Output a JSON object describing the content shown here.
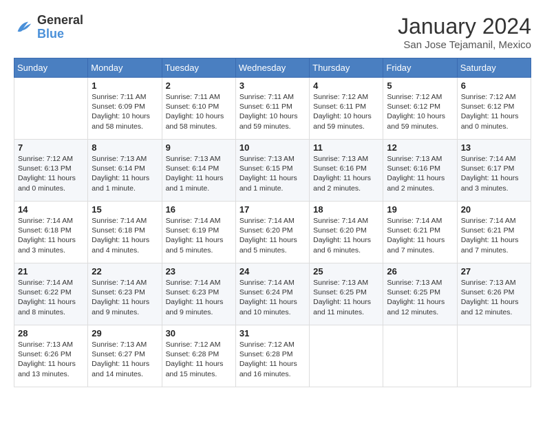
{
  "logo": {
    "general": "General",
    "blue": "Blue"
  },
  "title": "January 2024",
  "location": "San Jose Tejamanil, Mexico",
  "headers": [
    "Sunday",
    "Monday",
    "Tuesday",
    "Wednesday",
    "Thursday",
    "Friday",
    "Saturday"
  ],
  "weeks": [
    [
      {
        "day": "",
        "info": ""
      },
      {
        "day": "1",
        "info": "Sunrise: 7:11 AM\nSunset: 6:09 PM\nDaylight: 10 hours\nand 58 minutes."
      },
      {
        "day": "2",
        "info": "Sunrise: 7:11 AM\nSunset: 6:10 PM\nDaylight: 10 hours\nand 58 minutes."
      },
      {
        "day": "3",
        "info": "Sunrise: 7:11 AM\nSunset: 6:11 PM\nDaylight: 10 hours\nand 59 minutes."
      },
      {
        "day": "4",
        "info": "Sunrise: 7:12 AM\nSunset: 6:11 PM\nDaylight: 10 hours\nand 59 minutes."
      },
      {
        "day": "5",
        "info": "Sunrise: 7:12 AM\nSunset: 6:12 PM\nDaylight: 10 hours\nand 59 minutes."
      },
      {
        "day": "6",
        "info": "Sunrise: 7:12 AM\nSunset: 6:12 PM\nDaylight: 11 hours\nand 0 minutes."
      }
    ],
    [
      {
        "day": "7",
        "info": "Sunrise: 7:12 AM\nSunset: 6:13 PM\nDaylight: 11 hours\nand 0 minutes."
      },
      {
        "day": "8",
        "info": "Sunrise: 7:13 AM\nSunset: 6:14 PM\nDaylight: 11 hours\nand 1 minute."
      },
      {
        "day": "9",
        "info": "Sunrise: 7:13 AM\nSunset: 6:14 PM\nDaylight: 11 hours\nand 1 minute."
      },
      {
        "day": "10",
        "info": "Sunrise: 7:13 AM\nSunset: 6:15 PM\nDaylight: 11 hours\nand 1 minute."
      },
      {
        "day": "11",
        "info": "Sunrise: 7:13 AM\nSunset: 6:16 PM\nDaylight: 11 hours\nand 2 minutes."
      },
      {
        "day": "12",
        "info": "Sunrise: 7:13 AM\nSunset: 6:16 PM\nDaylight: 11 hours\nand 2 minutes."
      },
      {
        "day": "13",
        "info": "Sunrise: 7:14 AM\nSunset: 6:17 PM\nDaylight: 11 hours\nand 3 minutes."
      }
    ],
    [
      {
        "day": "14",
        "info": "Sunrise: 7:14 AM\nSunset: 6:18 PM\nDaylight: 11 hours\nand 3 minutes."
      },
      {
        "day": "15",
        "info": "Sunrise: 7:14 AM\nSunset: 6:18 PM\nDaylight: 11 hours\nand 4 minutes."
      },
      {
        "day": "16",
        "info": "Sunrise: 7:14 AM\nSunset: 6:19 PM\nDaylight: 11 hours\nand 5 minutes."
      },
      {
        "day": "17",
        "info": "Sunrise: 7:14 AM\nSunset: 6:20 PM\nDaylight: 11 hours\nand 5 minutes."
      },
      {
        "day": "18",
        "info": "Sunrise: 7:14 AM\nSunset: 6:20 PM\nDaylight: 11 hours\nand 6 minutes."
      },
      {
        "day": "19",
        "info": "Sunrise: 7:14 AM\nSunset: 6:21 PM\nDaylight: 11 hours\nand 7 minutes."
      },
      {
        "day": "20",
        "info": "Sunrise: 7:14 AM\nSunset: 6:21 PM\nDaylight: 11 hours\nand 7 minutes."
      }
    ],
    [
      {
        "day": "21",
        "info": "Sunrise: 7:14 AM\nSunset: 6:22 PM\nDaylight: 11 hours\nand 8 minutes."
      },
      {
        "day": "22",
        "info": "Sunrise: 7:14 AM\nSunset: 6:23 PM\nDaylight: 11 hours\nand 9 minutes."
      },
      {
        "day": "23",
        "info": "Sunrise: 7:14 AM\nSunset: 6:23 PM\nDaylight: 11 hours\nand 9 minutes."
      },
      {
        "day": "24",
        "info": "Sunrise: 7:14 AM\nSunset: 6:24 PM\nDaylight: 11 hours\nand 10 minutes."
      },
      {
        "day": "25",
        "info": "Sunrise: 7:13 AM\nSunset: 6:25 PM\nDaylight: 11 hours\nand 11 minutes."
      },
      {
        "day": "26",
        "info": "Sunrise: 7:13 AM\nSunset: 6:25 PM\nDaylight: 11 hours\nand 12 minutes."
      },
      {
        "day": "27",
        "info": "Sunrise: 7:13 AM\nSunset: 6:26 PM\nDaylight: 11 hours\nand 12 minutes."
      }
    ],
    [
      {
        "day": "28",
        "info": "Sunrise: 7:13 AM\nSunset: 6:26 PM\nDaylight: 11 hours\nand 13 minutes."
      },
      {
        "day": "29",
        "info": "Sunrise: 7:13 AM\nSunset: 6:27 PM\nDaylight: 11 hours\nand 14 minutes."
      },
      {
        "day": "30",
        "info": "Sunrise: 7:12 AM\nSunset: 6:28 PM\nDaylight: 11 hours\nand 15 minutes."
      },
      {
        "day": "31",
        "info": "Sunrise: 7:12 AM\nSunset: 6:28 PM\nDaylight: 11 hours\nand 16 minutes."
      },
      {
        "day": "",
        "info": ""
      },
      {
        "day": "",
        "info": ""
      },
      {
        "day": "",
        "info": ""
      }
    ]
  ]
}
